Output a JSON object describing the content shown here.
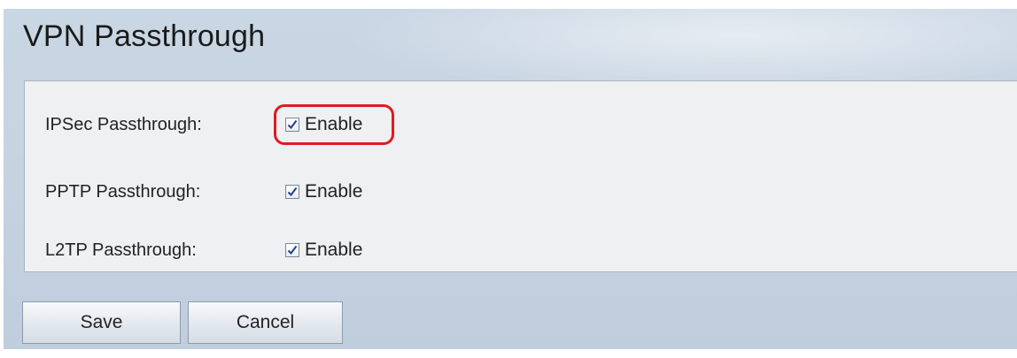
{
  "page": {
    "title": "VPN Passthrough"
  },
  "settings": [
    {
      "label": "IPSec Passthrough:",
      "option_label": "Enable",
      "checked": true
    },
    {
      "label": "PPTP Passthrough:",
      "option_label": "Enable",
      "checked": true
    },
    {
      "label": "L2TP Passthrough:",
      "option_label": "Enable",
      "checked": true
    }
  ],
  "buttons": {
    "save_label": "Save",
    "cancel_label": "Cancel"
  },
  "colors": {
    "highlight": "#e01a22",
    "check": "#1f3f8f"
  }
}
